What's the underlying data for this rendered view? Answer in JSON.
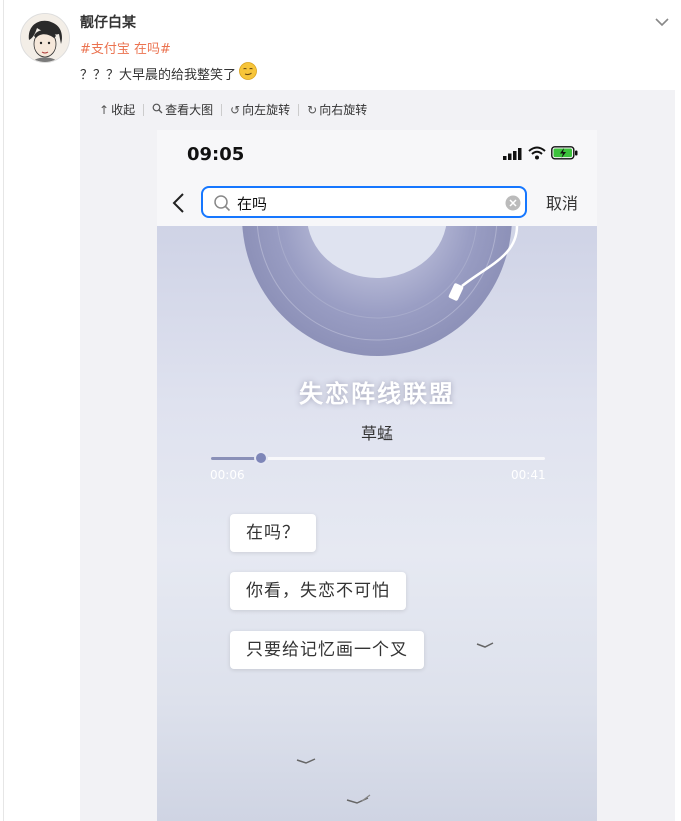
{
  "post": {
    "username": "靓仔白某",
    "hashtag": "#支付宝 在吗#",
    "text": "？？？大早晨的给我整笑了"
  },
  "toolbar": {
    "collapse": "收起",
    "view_large": "查看大图",
    "rotate_left": "向左旋转",
    "rotate_right": "向右旋转"
  },
  "phone": {
    "time": "09:05",
    "search_value": "在吗",
    "cancel": "取消",
    "song_title": "失恋阵线联盟",
    "artist": "草蜢",
    "elapsed": "00:06",
    "total": "00:41",
    "progress_fraction": 0.15,
    "lyrics": [
      "在吗？",
      "你看，失恋不可怕",
      "只要给记忆画一个叉"
    ]
  },
  "icons": {
    "battery": "battery-charging-icon",
    "signal": "signal-icon",
    "wifi": "wifi-icon"
  },
  "colors": {
    "hashtag": "#eb7350",
    "search_border": "#1677ff",
    "battery_fill": "#3cc23c"
  }
}
